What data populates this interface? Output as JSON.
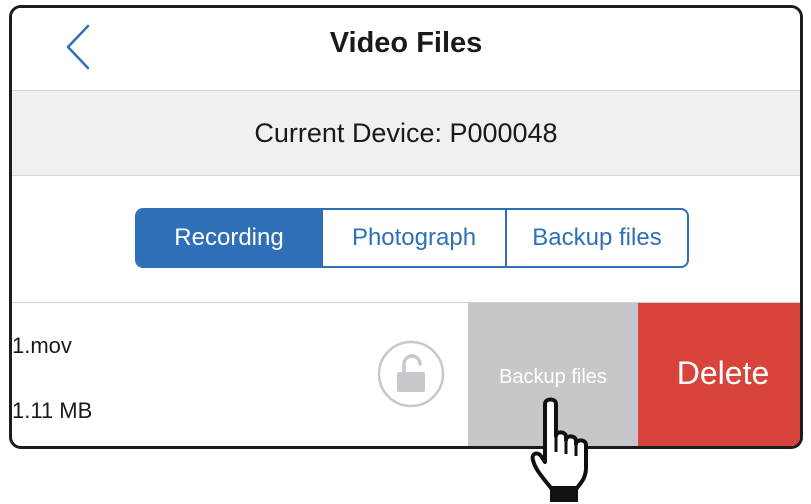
{
  "navbar": {
    "title": "Video Files",
    "back_icon": "chevron-left-icon"
  },
  "device": {
    "label": "Current Device: P000048"
  },
  "tabs": [
    {
      "label": "Recording",
      "active": true
    },
    {
      "label": "Photograph",
      "active": false
    },
    {
      "label": "Backup files",
      "active": false
    }
  ],
  "file": {
    "name": "1.mov",
    "size": "1.11 MB",
    "lock_icon": "unlocked-padlock-icon"
  },
  "swipe_actions": {
    "backup_label": "Backup files",
    "delete_label": "Delete"
  },
  "colors": {
    "accent": "#2f6fb8",
    "delete": "#d8433b",
    "backup": "#c6c6cb",
    "device_bar_bg": "#efeff4"
  },
  "overlay": {
    "pointer_icon": "pointing-hand-icon"
  }
}
